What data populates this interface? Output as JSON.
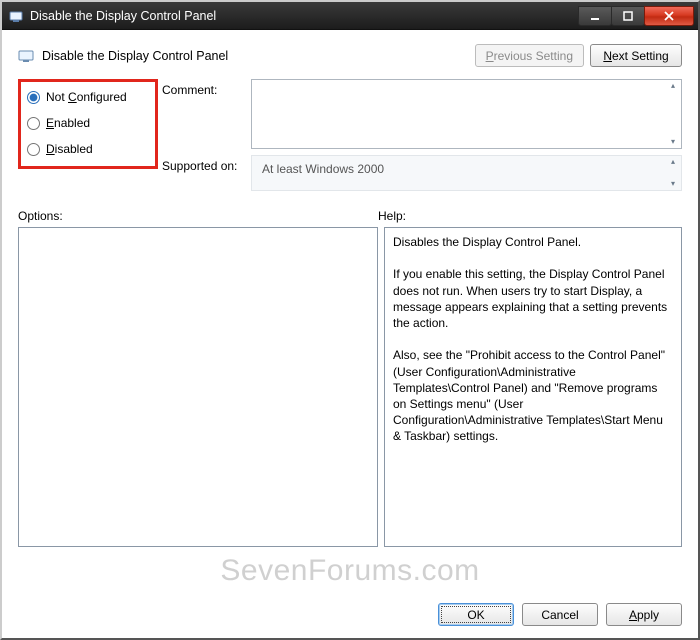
{
  "titlebar": {
    "title": "Disable the Display Control Panel"
  },
  "header": {
    "panel_title": "Disable the Display Control Panel",
    "previous_setting": "Previous Setting",
    "next_setting": "Next Setting"
  },
  "state": {
    "options": [
      {
        "label_pre": "Not ",
        "mn": "C",
        "label_post": "onfigured",
        "checked": true
      },
      {
        "label_pre": "",
        "mn": "E",
        "label_post": "nabled",
        "checked": false
      },
      {
        "label_pre": "",
        "mn": "D",
        "label_post": "isabled",
        "checked": false
      }
    ]
  },
  "labels": {
    "comment": "Comment:",
    "supported_on": "Supported on:",
    "options": "Options:",
    "help": "Help:"
  },
  "supported_on_text": "At least Windows 2000",
  "help_text": "Disables the Display Control Panel.\n\nIf you enable this setting, the Display Control Panel does not run. When users try to start Display, a message appears explaining that a setting prevents the action.\n\nAlso, see the \"Prohibit access to the Control Panel\" (User Configuration\\Administrative Templates\\Control Panel) and \"Remove programs on Settings menu\" (User Configuration\\Administrative Templates\\Start Menu & Taskbar) settings.",
  "footer": {
    "ok": "OK",
    "cancel": "Cancel",
    "apply": "Apply"
  },
  "watermark": "SevenForums.com"
}
